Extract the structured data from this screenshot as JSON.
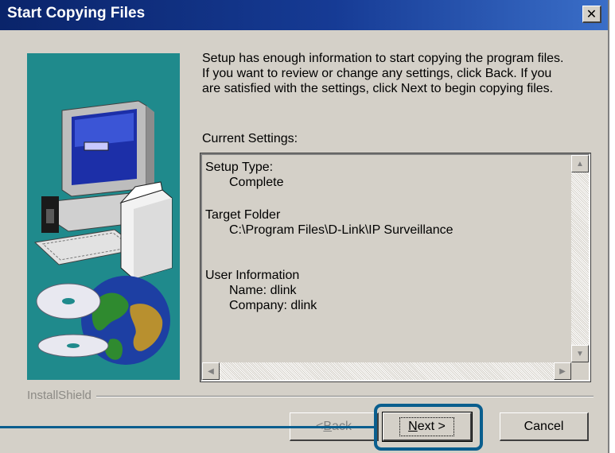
{
  "window": {
    "title": "Start Copying Files",
    "close_glyph": "✕"
  },
  "description": {
    "lines": [
      "Setup has enough information to start copying the program files.",
      "If you want to review or change any settings, click Back.  If you",
      "are satisfied with the settings, click Next to begin copying files."
    ]
  },
  "settings": {
    "label": "Current Settings:",
    "setup_type_label": "Setup Type:",
    "setup_type_value": "Complete",
    "target_folder_label": "Target Folder",
    "target_folder_value": "C:\\Program Files\\D-Link\\IP Surveillance",
    "user_info_label": "User Information",
    "name_line": "Name:  dlink",
    "company_line": "Company:  dlink"
  },
  "footer": {
    "brand": "InstallShield"
  },
  "buttons": {
    "back_arrow": "< ",
    "back_accel": "B",
    "back_rest": "ack",
    "next_accel": "N",
    "next_rest": "ext >",
    "cancel": "Cancel"
  },
  "colors": {
    "titlebar": "#0a246a",
    "dialog_face": "#d4d0c8",
    "art_background": "#1f8a8c",
    "callout": "#0a5e8e"
  }
}
